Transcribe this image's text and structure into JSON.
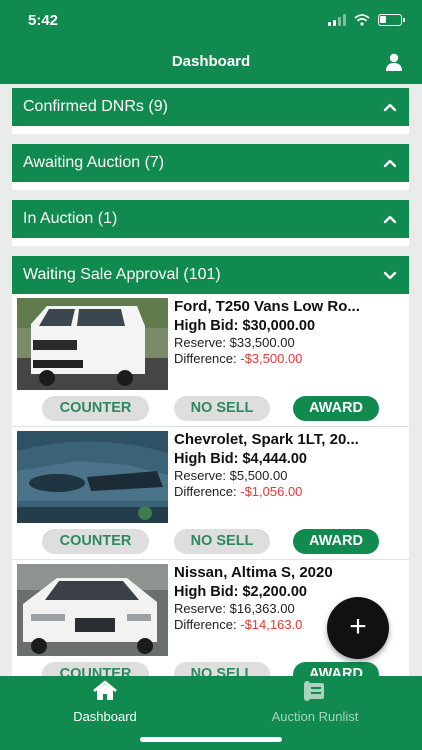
{
  "status_bar": {
    "time": "5:42"
  },
  "header": {
    "title": "Dashboard"
  },
  "sections": [
    {
      "title": "Confirmed DNRs (9)"
    },
    {
      "title": "Awaiting Auction (7)"
    },
    {
      "title": "In Auction (1)"
    },
    {
      "title": "Waiting Sale Approval (101)"
    }
  ],
  "vehicles": [
    {
      "title": "Ford, T250 Vans Low Ro...",
      "high_bid": "High Bid: $30,000.00",
      "reserve": "Reserve: $33,500.00",
      "difference_label": "Difference: ",
      "difference_value": "-$3,500.00",
      "image": "white-cargo-van"
    },
    {
      "title": "Chevrolet, Spark 1LT, 20...",
      "high_bid": "High Bid: $4,444.00",
      "reserve": "Reserve: $5,500.00",
      "difference_label": "Difference: ",
      "difference_value": "-$1,056.00",
      "image": "blue-car-front"
    },
    {
      "title": "Nissan, Altima S, 2020",
      "high_bid": "High Bid: $2,200.00",
      "reserve": "Reserve: $16,363.00",
      "difference_label": "Difference: ",
      "difference_value": "-$14,163.0",
      "image": "white-sedan"
    }
  ],
  "actions": {
    "counter": "COUNTER",
    "no_sell": "NO SELL",
    "award": "AWARD"
  },
  "fab": {
    "label": "+"
  },
  "tabs": [
    {
      "label": "Dashboard",
      "icon": "home-icon",
      "active": true
    },
    {
      "label": "Auction Runlist",
      "icon": "runlist-icon",
      "active": false
    }
  ],
  "colors": {
    "brand": "#118a4f",
    "negative": "#e53935",
    "pill_bg": "#dedede",
    "pill_text": "#2d8a5e"
  }
}
